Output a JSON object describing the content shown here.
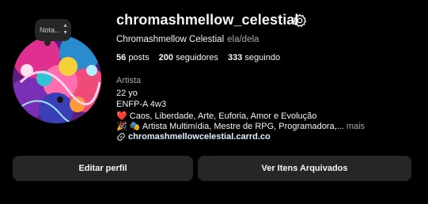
{
  "profile": {
    "username": "chromashmellow_celestial",
    "full_name": "Chromashmellow Celestial",
    "pronouns": "ela/dela",
    "note_label": "Nota...",
    "stats": [
      {
        "count": "56",
        "label": "posts"
      },
      {
        "count": "200",
        "label": "seguidores"
      },
      {
        "count": "333",
        "label": "seguindo"
      }
    ],
    "category": "Artista",
    "bio": {
      "line1": "22 yo",
      "line2": "ENFP-A 4w3",
      "line3": "❤️ Caos, Liberdade, Arte, Euforia, Amor e Evolução",
      "line4": "🎉 🎭 Artista Multimídia, Mestre de RPG, Programadora,...",
      "more": "mais"
    },
    "link": "chromashmellowcelestial.carrd.co"
  },
  "actions": {
    "edit_profile": "Editar perfil",
    "archived": "Ver Itens Arquivados"
  },
  "icons": {
    "settings": "gear-icon",
    "link": "link-icon",
    "note_arrows": "chevron-updown-icon"
  },
  "colors": {
    "background": "#000000",
    "button": "#262626",
    "muted_text": "#a8a8a8",
    "link_text": "#e0f1ff"
  }
}
